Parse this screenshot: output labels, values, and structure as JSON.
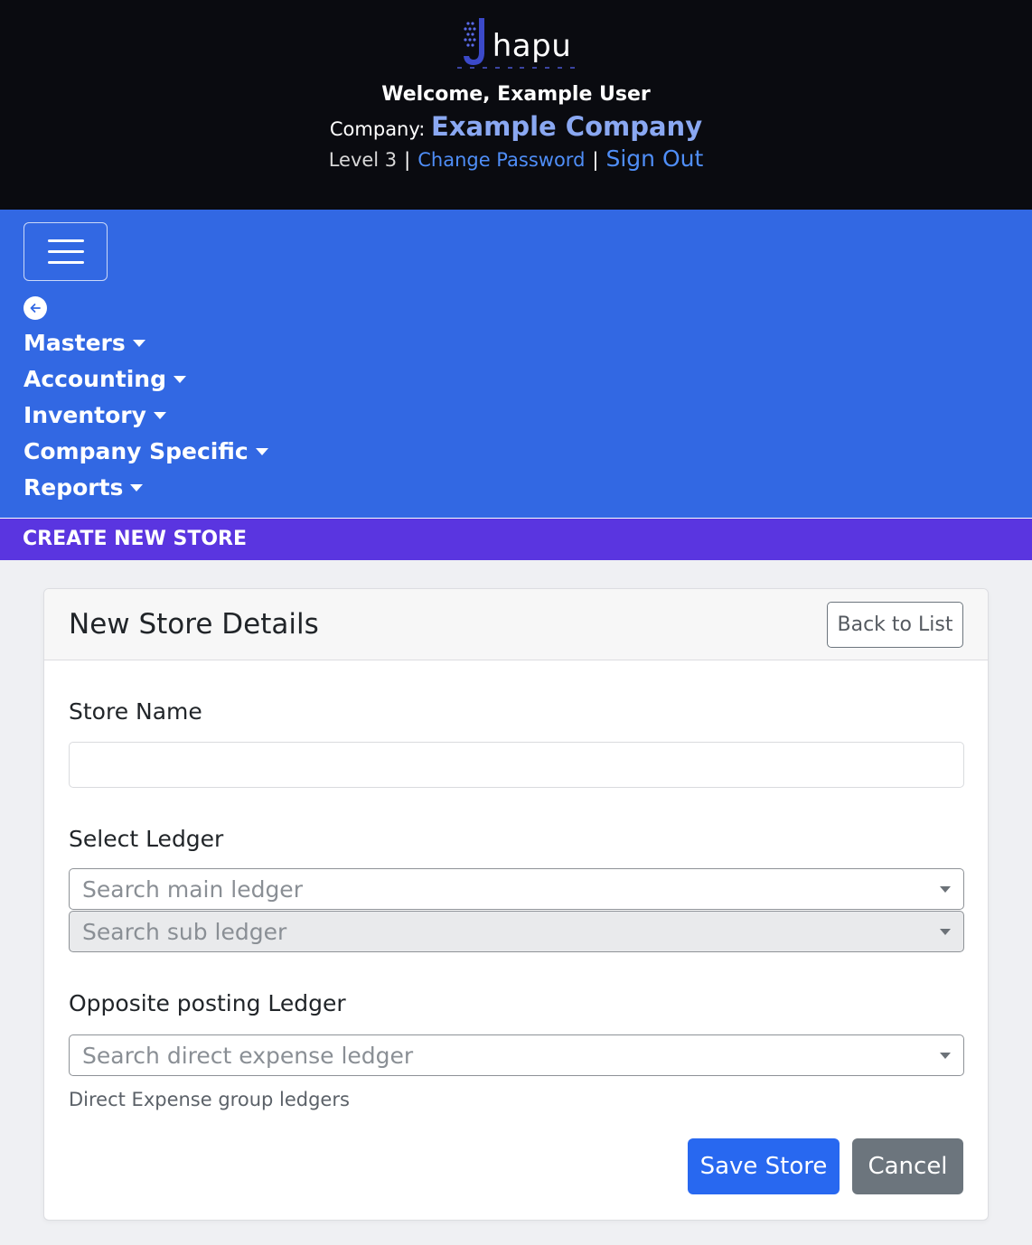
{
  "header": {
    "logo_text": "hapu",
    "welcome": "Welcome, Example User",
    "company_label": "Company:",
    "company_name": "Example Company",
    "level": "Level 3",
    "separator": "|",
    "change_password": "Change Password",
    "sign_out": "Sign Out"
  },
  "nav": {
    "items": [
      {
        "label": "Masters"
      },
      {
        "label": "Accounting"
      },
      {
        "label": "Inventory"
      },
      {
        "label": "Company Specific"
      },
      {
        "label": "Reports"
      }
    ]
  },
  "page_title": "CREATE NEW STORE",
  "card": {
    "title": "New Store Details",
    "back_button": "Back to List"
  },
  "form": {
    "store_name": {
      "label": "Store Name",
      "value": "",
      "placeholder": ""
    },
    "ledger": {
      "label": "Select Ledger",
      "main_placeholder": "Search main ledger",
      "sub_placeholder": "Search sub ledger"
    },
    "opposite": {
      "label": "Opposite posting Ledger",
      "placeholder": "Search direct expense ledger",
      "help": "Direct Expense group ledgers"
    },
    "save_button": "Save Store",
    "cancel_button": "Cancel"
  },
  "colors": {
    "header_bg": "#0a0b10",
    "nav_bg": "#3268e3",
    "title_bar_bg": "#5a35e0",
    "primary": "#2868f0",
    "secondary": "#6c757d",
    "link": "#4f8ef7"
  },
  "icons": {
    "logo": "jhapu-logo-icon",
    "menu": "hamburger-menu-icon",
    "back": "arrow-left-circle-icon",
    "dropdown": "caret-down-icon"
  }
}
